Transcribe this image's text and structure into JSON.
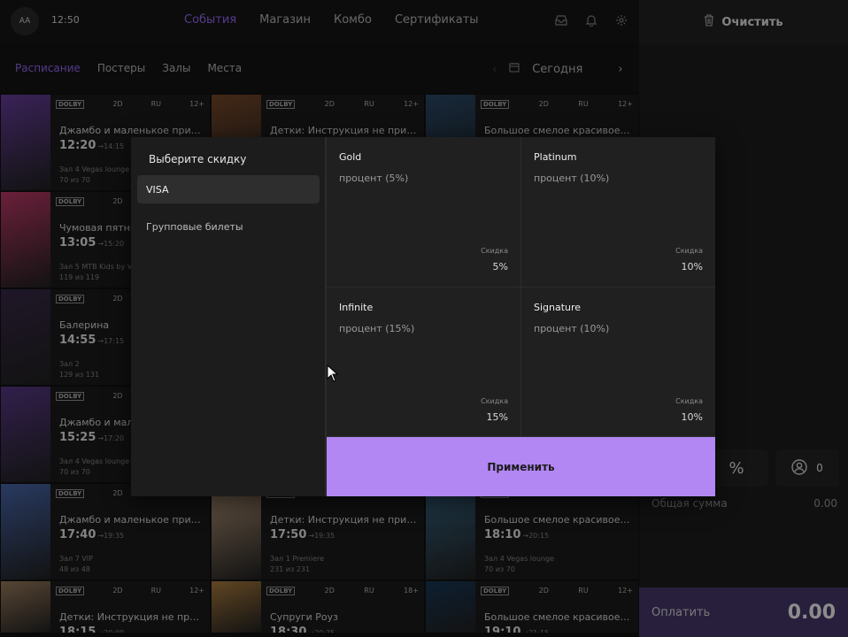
{
  "topbar": {
    "avatar": "AA",
    "clock": "12:50",
    "nav": [
      "События",
      "Магазин",
      "Комбо",
      "Сертификаты"
    ],
    "active_nav": "События"
  },
  "right_panel": {
    "clear_label": "Очистить",
    "percent_symbol": "%",
    "counter": "0",
    "total_label": "Общая сумма",
    "total_value": "0.00",
    "pay_label": "Оплатить",
    "pay_amount": "0.00"
  },
  "subnav": {
    "tabs": [
      "Расписание",
      "Постеры",
      "Залы",
      "Места"
    ],
    "active_tab": "Расписание",
    "date_label": "Сегодня"
  },
  "schedule": {
    "dolby_label": "DOLBY",
    "columns": [
      [
        {
          "format": "2D",
          "lang": "RU",
          "age": "12+",
          "title": "Джамбо и маленькое привид...",
          "time": "12:20",
          "end": "→14:15",
          "hall": "Зал 4 Vegas lounge",
          "seats": "70 из 70"
        },
        {
          "format": "2D",
          "lang": "RU",
          "age": "12+",
          "title": "Чумовая пятница",
          "time": "13:05",
          "end": "→15:20",
          "hall": "Зал 5 MTB Kids by Vis",
          "seats": "119 из 119"
        },
        {
          "format": "2D",
          "lang": "RU",
          "age": "12+",
          "title": "Балерина",
          "time": "14:55",
          "end": "→17:15",
          "hall": "Зал 2",
          "seats": "129 из 131"
        },
        {
          "format": "2D",
          "lang": "RU",
          "age": "12+",
          "title": "Джамбо и маленькое привид...",
          "time": "15:25",
          "end": "→17:20",
          "hall": "Зал 4 Vegas lounge",
          "seats": "70 из 70"
        },
        {
          "format": "2D",
          "lang": "RU",
          "age": "12+",
          "title": "Джамбо и маленькое привид...",
          "time": "17:40",
          "end": "→19:35",
          "hall": "Зал 7 VIP",
          "seats": "48 из 48"
        },
        {
          "format": "2D",
          "lang": "RU",
          "age": "12+",
          "title": "Детки: Инструкция не прилаг...",
          "time": "18:15",
          "end": "→20:00",
          "hall": "",
          "seats": ""
        }
      ],
      [
        {
          "format": "2D",
          "lang": "RU",
          "age": "12+",
          "title": "Детки: Инструкция не прилаг...",
          "time": "",
          "end": "",
          "hall": "",
          "seats": ""
        },
        {
          "format": "2D",
          "lang": "RU",
          "age": "12+",
          "title": "Детки: Инструкция не прилаг...",
          "time": "17:50",
          "end": "→19:35",
          "hall": "Зал 1 Premiere",
          "seats": "231 из 231"
        },
        {
          "format": "2D",
          "lang": "RU",
          "age": "18+",
          "title": "Супруги Роуз",
          "time": "18:30",
          "end": "→20:35",
          "hall": "",
          "seats": ""
        }
      ],
      [
        {
          "format": "2D",
          "lang": "RU",
          "age": "12+",
          "title": "Большое смелое красивое пу...",
          "time": "",
          "end": "",
          "hall": "",
          "seats": ""
        },
        {
          "format": "2D",
          "lang": "RU",
          "age": "12+",
          "title": "Большое смелое красивое пу...",
          "time": "18:10",
          "end": "→20:15",
          "hall": "Зал 4 Vegas lounge",
          "seats": "70 из 70"
        },
        {
          "format": "2D",
          "lang": "RU",
          "age": "12+",
          "title": "Большое смелое красивое пу...",
          "time": "19:10",
          "end": "→21:15",
          "hall": "",
          "seats": ""
        }
      ]
    ]
  },
  "discount_modal": {
    "title": "Выберите скидку",
    "options": [
      "VISA",
      "Групповые билеты"
    ],
    "selected": "VISA",
    "discount_label": "Скидка",
    "cards": [
      {
        "name": "Gold",
        "type": "процент (5%)",
        "value": "5%"
      },
      {
        "name": "Platinum",
        "type": "процент (10%)",
        "value": "10%"
      },
      {
        "name": "Infinite",
        "type": "процент (15%)",
        "value": "15%"
      },
      {
        "name": "Signature",
        "type": "процент (10%)",
        "value": "10%"
      }
    ],
    "apply_label": "Применить"
  },
  "colors": {
    "accent": "#9c6cff",
    "apply_button": "#b286f3",
    "pay_bar": "#4a3a6e"
  },
  "icons": [
    "inbox-icon",
    "bell-icon",
    "gear-icon",
    "trash-icon",
    "percent-icon",
    "user-icon",
    "calendar-icon",
    "chevron-left-icon",
    "chevron-right-icon",
    "cursor-icon"
  ]
}
